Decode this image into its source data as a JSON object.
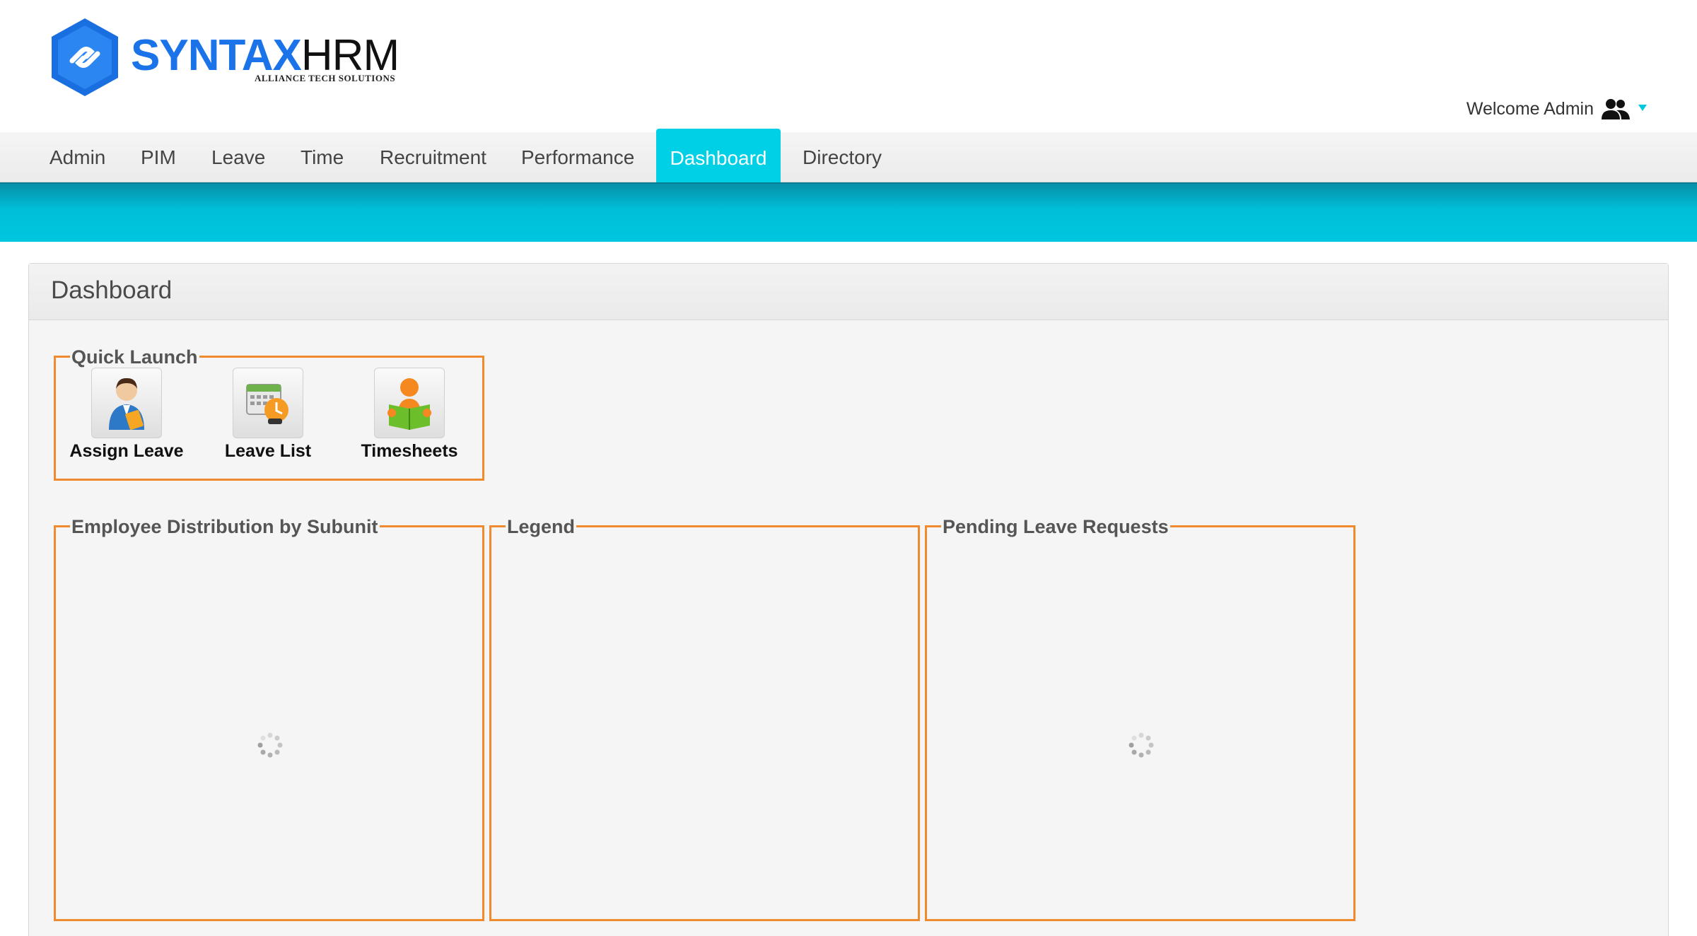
{
  "brand": {
    "name_part1": "SYNTAX",
    "name_part2": "HRM",
    "tagline": "ALLIANCE TECH SOLUTIONS",
    "logo_icon": "hexagon-link-icon",
    "colors": {
      "primary": "#1a73e8",
      "dark": "#111111"
    }
  },
  "user": {
    "welcome": "Welcome Admin",
    "icon": "users-icon",
    "caret_icon": "caret-down-icon"
  },
  "nav": {
    "items": [
      {
        "label": "Admin"
      },
      {
        "label": "PIM"
      },
      {
        "label": "Leave"
      },
      {
        "label": "Time"
      },
      {
        "label": "Recruitment"
      },
      {
        "label": "Performance"
      },
      {
        "label": "Dashboard",
        "active": true
      },
      {
        "label": "Directory"
      }
    ],
    "active_color": "#00d0e6"
  },
  "panel": {
    "title": "Dashboard"
  },
  "quick_launch": {
    "title": "Quick Launch",
    "items": [
      {
        "label": "Assign Leave",
        "icon": "assign-leave-icon"
      },
      {
        "label": "Leave List",
        "icon": "leave-list-icon"
      },
      {
        "label": "Timesheets",
        "icon": "timesheets-icon"
      }
    ]
  },
  "widgets": [
    {
      "title": "Employee Distribution by Subunit",
      "loading": true
    },
    {
      "title": "Legend",
      "loading": false
    },
    {
      "title": "Pending Leave Requests",
      "loading": true
    }
  ],
  "accent_color": "#f08a2e"
}
